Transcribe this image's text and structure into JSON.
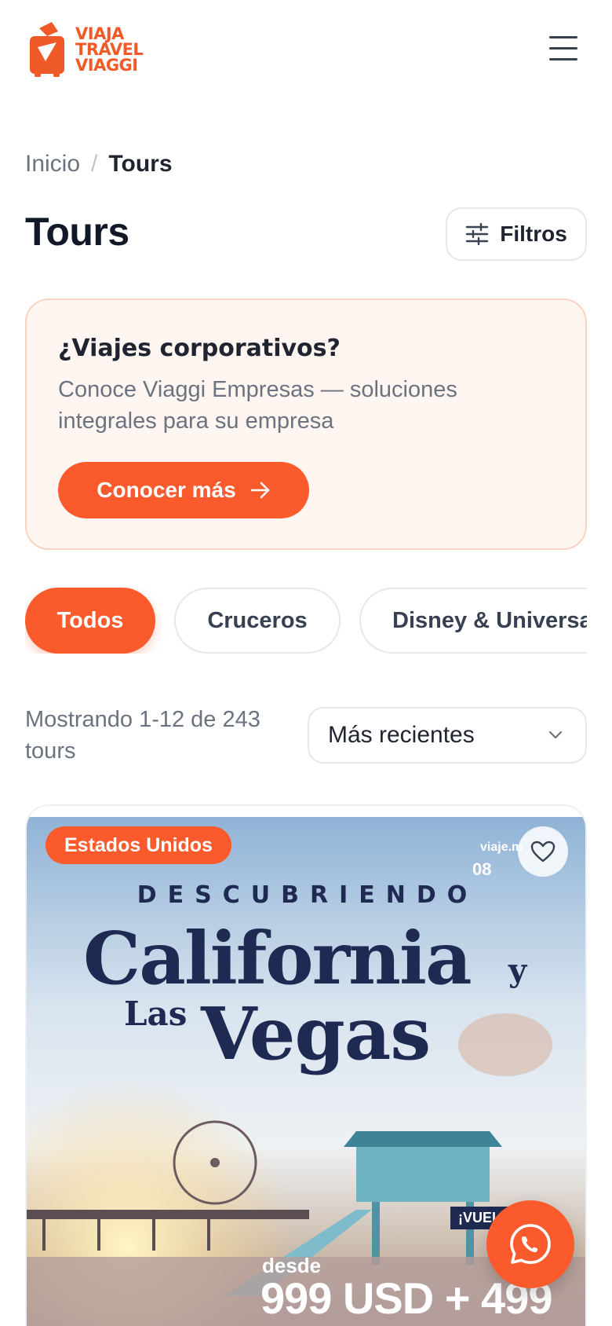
{
  "brand": {
    "line1": "VIAJA",
    "line2": "TRAVEL",
    "line3": "VIAGGI",
    "color": "#f05a28",
    "icon": "suitcase-logo-icon"
  },
  "header": {
    "menu_icon": "hamburger-menu-icon"
  },
  "breadcrumb": {
    "home": "Inicio",
    "separator": "/",
    "current": "Tours"
  },
  "page": {
    "title": "Tours",
    "filter_label": "Filtros",
    "filter_icon": "sliders-icon"
  },
  "promo": {
    "title": "¿Viajes corporativos?",
    "text": "Conoce Viaggi Empresas — soluciones integrales para su empresa",
    "button_label": "Conocer más",
    "button_icon": "arrow-right-icon",
    "accent": "#fb5b2c",
    "background": "#fff5f1"
  },
  "tabs": [
    {
      "label": "Todos",
      "active": true
    },
    {
      "label": "Cruceros",
      "active": false
    },
    {
      "label": "Disney & Universal",
      "active": false
    }
  ],
  "results": {
    "count_text": "Mostrando 1-12 de 243 tours",
    "sort_selected": "Más recientes",
    "sort_icon": "chevron-down-icon"
  },
  "card": {
    "badge": "Estados Unidos",
    "favorite_icon": "heart-icon",
    "image": {
      "watermark": "viaje.m",
      "weather": "08",
      "subtitle": "DESCUBRIENDO",
      "title_1": "California",
      "title_y": "y",
      "title_las": "Las",
      "title_2": "Vegas",
      "flight_tag": "¡VUEL",
      "desde": "desde",
      "price": "999 USD + 499"
    }
  },
  "floating": {
    "whatsapp_icon": "whatsapp-icon",
    "color": "#fb5b2c"
  }
}
